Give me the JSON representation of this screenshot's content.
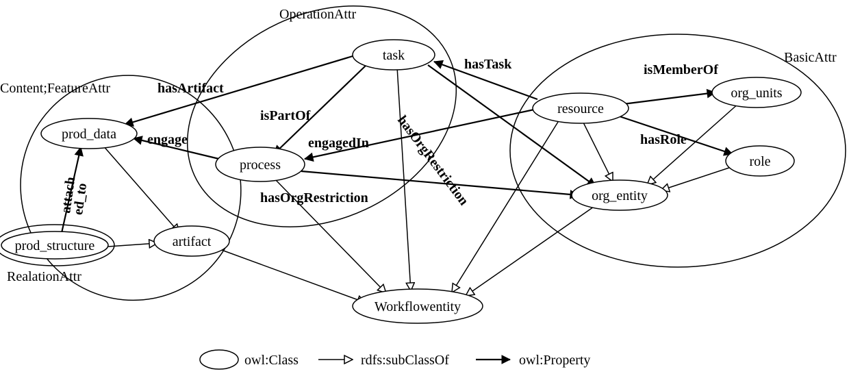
{
  "groups": {
    "operation": "OperationAttr",
    "content_feature": "Content;FeatureAttr",
    "basic": "BasicAttr",
    "relation": "RealationAttr"
  },
  "classes": {
    "task": "task",
    "process": "process",
    "prod_data": "prod_data",
    "prod_structure": "prod_structure",
    "artifact": "artifact",
    "resource": "resource",
    "org_units": "org_units",
    "role": "role",
    "org_entity": "org_entity",
    "workflowentity": "Workflowentity"
  },
  "edges": {
    "hasArtifact": "hasArtifact",
    "isPartOf": "isPartOf",
    "engage": "engage",
    "engagedIn": "engagedIn",
    "attached_to": "attach\ned_to",
    "hasTask": "hasTask",
    "isMemberOf": "isMemberOf",
    "hasRole": "hasRole",
    "hasOrgRestriction_task": "hasOrgRestriction",
    "hasOrgRestriction_process": "hasOrgRestriction"
  },
  "legend": {
    "owl_class": "owl:Class",
    "subclass": "rdfs:subClassOf",
    "property": "owl:Property"
  }
}
